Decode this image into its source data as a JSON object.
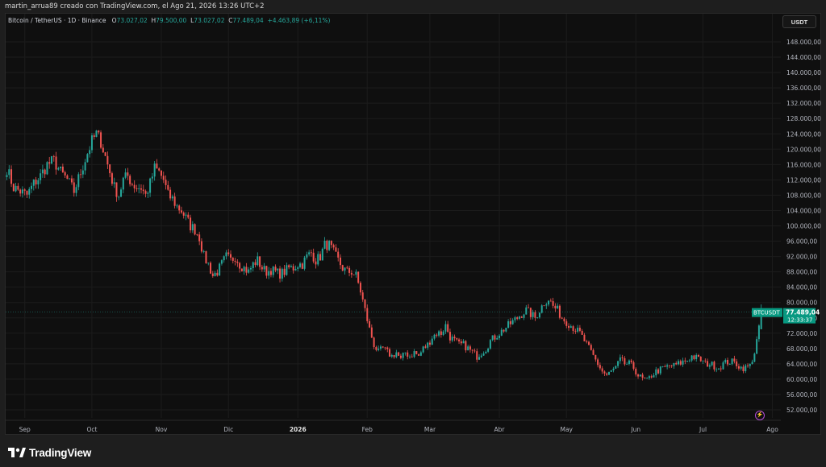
{
  "header": {
    "attribution": "martin_arrua89 creado con TradingView.com, el Ago 21, 2026 13:26 UTC+2"
  },
  "legend": {
    "symbol": "Bitcoin / TetherUS · 1D · Binance",
    "o_label": "O",
    "o_value": "73.027,02",
    "h_label": "H",
    "h_value": "79.500,00",
    "l_label": "L",
    "l_value": "73.027,02",
    "c_label": "C",
    "c_value": "77.489,04",
    "change": "+4.463,89 (+6,11%)"
  },
  "currency_button": "USDT",
  "price_tag": {
    "symbol": "BTCUSDT",
    "price": "77.489,04",
    "countdown": "12:33:37"
  },
  "brand": {
    "name": "TradingView"
  },
  "icons": {
    "alert": "lightning-icon",
    "logo": "tradingview-logo-icon"
  },
  "colors": {
    "up": "#26a69a",
    "down": "#ef5350",
    "grid": "#1c1c1c",
    "axis_text": "#b2b5be",
    "price_line": "#26a69a",
    "tag_bg": "#089981"
  },
  "chart_data": {
    "type": "candlestick",
    "interval": "1D",
    "ylim": [
      50000,
      150000
    ],
    "y_ticks": [
      52000,
      56000,
      60000,
      64000,
      68000,
      72000,
      76000,
      80000,
      84000,
      88000,
      92000,
      96000,
      100000,
      104000,
      108000,
      112000,
      116000,
      120000,
      124000,
      128000,
      132000,
      136000,
      140000,
      144000,
      148000
    ],
    "y_tick_labels": [
      "52.000,00",
      "56.000,00",
      "60.000,00",
      "64.000,00",
      "68.000,00",
      "72.000,00",
      "76.000,00",
      "80.000,00",
      "84.000,00",
      "88.000,00",
      "92.000,00",
      "96.000,00",
      "100.000,00",
      "104.000,00",
      "108.000,00",
      "112.000,00",
      "116.000,00",
      "120.000,00",
      "124.000,00",
      "128.000,00",
      "132.000,00",
      "136.000,00",
      "140.000,00",
      "144.000,00",
      "148.000,00"
    ],
    "x_labels": [
      {
        "label": "Sep",
        "bar": 8
      },
      {
        "label": "Oct",
        "bar": 38
      },
      {
        "label": "Nov",
        "bar": 69
      },
      {
        "label": "Dic",
        "bar": 99
      },
      {
        "label": "2026",
        "bar": 130,
        "bold": true
      },
      {
        "label": "Feb",
        "bar": 161
      },
      {
        "label": "Mar",
        "bar": 189
      },
      {
        "label": "Abr",
        "bar": 220
      },
      {
        "label": "May",
        "bar": 250
      },
      {
        "label": "Jun",
        "bar": 281
      },
      {
        "label": "Jul",
        "bar": 311
      },
      {
        "label": "Ago",
        "bar": 342
      }
    ],
    "last_close": 77489.04,
    "close_path": [
      [
        0,
        115000
      ],
      [
        3,
        110000
      ],
      [
        6,
        109000
      ],
      [
        9,
        108000
      ],
      [
        12,
        111000
      ],
      [
        15,
        113000
      ],
      [
        18,
        116000
      ],
      [
        21,
        117000
      ],
      [
        24,
        114000
      ],
      [
        27,
        112000
      ],
      [
        30,
        109000
      ],
      [
        33,
        114000
      ],
      [
        36,
        119000
      ],
      [
        38,
        122000
      ],
      [
        40,
        124000
      ],
      [
        42,
        122000
      ],
      [
        44,
        118000
      ],
      [
        46,
        114000
      ],
      [
        48,
        110000
      ],
      [
        50,
        108000
      ],
      [
        52,
        112000
      ],
      [
        54,
        113000
      ],
      [
        56,
        111000
      ],
      [
        58,
        110000
      ],
      [
        60,
        110000
      ],
      [
        62,
        108000
      ],
      [
        64,
        111000
      ],
      [
        66,
        115000
      ],
      [
        68,
        114000
      ],
      [
        70,
        112000
      ],
      [
        72,
        108000
      ],
      [
        74,
        107000
      ],
      [
        76,
        105000
      ],
      [
        78,
        104000
      ],
      [
        80,
        102000
      ],
      [
        82,
        100000
      ],
      [
        84,
        99000
      ],
      [
        86,
        97000
      ],
      [
        88,
        92000
      ],
      [
        90,
        90000
      ],
      [
        92,
        87000
      ],
      [
        94,
        88000
      ],
      [
        96,
        90000
      ],
      [
        98,
        92000
      ],
      [
        100,
        91000
      ],
      [
        102,
        92000
      ],
      [
        104,
        90000
      ],
      [
        106,
        89000
      ],
      [
        108,
        88000
      ],
      [
        110,
        90000
      ],
      [
        112,
        91000
      ],
      [
        114,
        89000
      ],
      [
        116,
        88000
      ],
      [
        118,
        88500
      ],
      [
        120,
        88000
      ],
      [
        122,
        87500
      ],
      [
        124,
        88000
      ],
      [
        126,
        89000
      ],
      [
        128,
        89000
      ],
      [
        130,
        90000
      ],
      [
        132,
        90000
      ],
      [
        134,
        92000
      ],
      [
        136,
        93000
      ],
      [
        138,
        91000
      ],
      [
        140,
        92000
      ],
      [
        142,
        95000
      ],
      [
        144,
        95000
      ],
      [
        146,
        93000
      ],
      [
        148,
        91000
      ],
      [
        150,
        89000
      ],
      [
        152,
        88000
      ],
      [
        154,
        88000
      ],
      [
        156,
        87000
      ],
      [
        158,
        83000
      ],
      [
        160,
        78000
      ],
      [
        162,
        73000
      ],
      [
        164,
        69000
      ],
      [
        166,
        67000
      ],
      [
        168,
        68000
      ],
      [
        170,
        67000
      ],
      [
        172,
        66000
      ],
      [
        174,
        67000
      ],
      [
        176,
        65000
      ],
      [
        178,
        67000
      ],
      [
        180,
        66000
      ],
      [
        182,
        67000
      ],
      [
        184,
        66000
      ],
      [
        186,
        68000
      ],
      [
        188,
        69000
      ],
      [
        190,
        71000
      ],
      [
        192,
        72000
      ],
      [
        194,
        72000
      ],
      [
        196,
        74000
      ],
      [
        198,
        71000
      ],
      [
        200,
        70000
      ],
      [
        202,
        69000
      ],
      [
        204,
        69000
      ],
      [
        206,
        68000
      ],
      [
        208,
        67000
      ],
      [
        210,
        66000
      ],
      [
        212,
        67000
      ],
      [
        214,
        68000
      ],
      [
        216,
        70000
      ],
      [
        218,
        71000
      ],
      [
        220,
        72000
      ],
      [
        222,
        73000
      ],
      [
        224,
        74000
      ],
      [
        226,
        75000
      ],
      [
        228,
        76000
      ],
      [
        230,
        77000
      ],
      [
        232,
        78000
      ],
      [
        234,
        77000
      ],
      [
        236,
        76000
      ],
      [
        238,
        78000
      ],
      [
        240,
        80000
      ],
      [
        242,
        81000
      ],
      [
        244,
        79000
      ],
      [
        246,
        78000
      ],
      [
        248,
        76000
      ],
      [
        250,
        75000
      ],
      [
        252,
        74000
      ],
      [
        254,
        73000
      ],
      [
        256,
        72000
      ],
      [
        258,
        70000
      ],
      [
        260,
        68000
      ],
      [
        262,
        66000
      ],
      [
        264,
        64000
      ],
      [
        266,
        62000
      ],
      [
        268,
        61000
      ],
      [
        270,
        62000
      ],
      [
        272,
        63000
      ],
      [
        274,
        65000
      ],
      [
        276,
        64000
      ],
      [
        278,
        64000
      ],
      [
        280,
        63000
      ],
      [
        282,
        61000
      ],
      [
        284,
        60000
      ],
      [
        286,
        59500
      ],
      [
        288,
        61000
      ],
      [
        290,
        62000
      ],
      [
        292,
        62500
      ],
      [
        294,
        63000
      ],
      [
        296,
        63500
      ],
      [
        298,
        63500
      ],
      [
        300,
        64000
      ],
      [
        302,
        64500
      ],
      [
        304,
        65000
      ],
      [
        306,
        66000
      ],
      [
        308,
        65500
      ],
      [
        310,
        65000
      ],
      [
        312,
        64000
      ],
      [
        314,
        64000
      ],
      [
        316,
        63500
      ],
      [
        318,
        63000
      ],
      [
        320,
        64000
      ],
      [
        322,
        64500
      ],
      [
        324,
        64500
      ],
      [
        326,
        64000
      ],
      [
        328,
        63000
      ],
      [
        330,
        63000
      ],
      [
        332,
        63500
      ],
      [
        334,
        67000
      ],
      [
        336,
        73000
      ],
      [
        337,
        77489
      ]
    ]
  }
}
